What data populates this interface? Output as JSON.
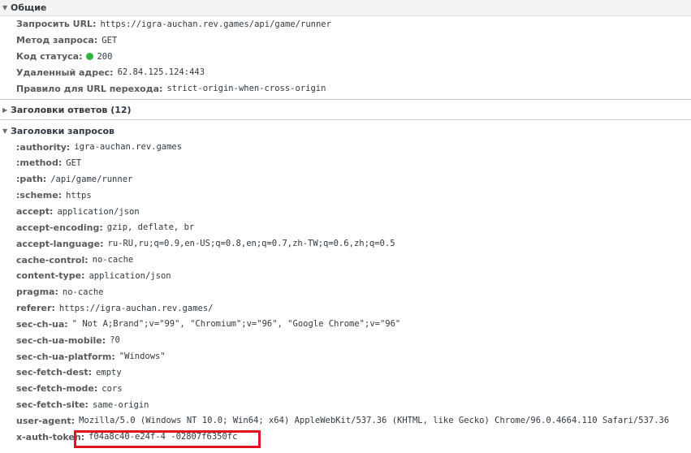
{
  "general": {
    "title": "Общие",
    "expand_glyph": "▼",
    "rows": [
      {
        "key": "Запросить URL:",
        "value": "https://igra-auchan.rev.games/api/game/runner"
      },
      {
        "key": "Метод запроса:",
        "value": "GET"
      },
      {
        "key": "Код статуса:",
        "value": "200",
        "status_color": "#36b240"
      },
      {
        "key": "Удаленный адрес:",
        "value": "62.84.125.124:443"
      },
      {
        "key": "Правило для URL перехода:",
        "value": "strict-origin-when-cross-origin"
      }
    ]
  },
  "response_headers": {
    "title": "Заголовки ответов (12)",
    "expand_glyph": "▶"
  },
  "request_headers": {
    "title": "Заголовки запросов",
    "expand_glyph": "▼",
    "rows": [
      {
        "key": ":authority:",
        "value": "igra-auchan.rev.games"
      },
      {
        "key": ":method:",
        "value": "GET"
      },
      {
        "key": ":path:",
        "value": "/api/game/runner"
      },
      {
        "key": ":scheme:",
        "value": "https"
      },
      {
        "key": "accept:",
        "value": "application/json"
      },
      {
        "key": "accept-encoding:",
        "value": "gzip, deflate, br"
      },
      {
        "key": "accept-language:",
        "value": "ru-RU,ru;q=0.9,en-US;q=0.8,en;q=0.7,zh-TW;q=0.6,zh;q=0.5"
      },
      {
        "key": "cache-control:",
        "value": "no-cache"
      },
      {
        "key": "content-type:",
        "value": "application/json"
      },
      {
        "key": "pragma:",
        "value": "no-cache"
      },
      {
        "key": "referer:",
        "value": "https://igra-auchan.rev.games/"
      },
      {
        "key": "sec-ch-ua:",
        "value": "\" Not A;Brand\";v=\"99\", \"Chromium\";v=\"96\", \"Google Chrome\";v=\"96\""
      },
      {
        "key": "sec-ch-ua-mobile:",
        "value": "?0"
      },
      {
        "key": "sec-ch-ua-platform:",
        "value": "\"Windows\""
      },
      {
        "key": "sec-fetch-dest:",
        "value": "empty"
      },
      {
        "key": "sec-fetch-mode:",
        "value": "cors"
      },
      {
        "key": "sec-fetch-site:",
        "value": "same-origin"
      },
      {
        "key": "user-agent:",
        "value": "Mozilla/5.0 (Windows NT 10.0; Win64; x64) AppleWebKit/537.36 (KHTML, like Gecko) Chrome/96.0.4664.110 Safari/537.36"
      },
      {
        "key": "x-auth-token:",
        "value": "f04a8c40-e24f-4           -02807f6350fc"
      }
    ]
  },
  "highlight_color": "#e0141e"
}
